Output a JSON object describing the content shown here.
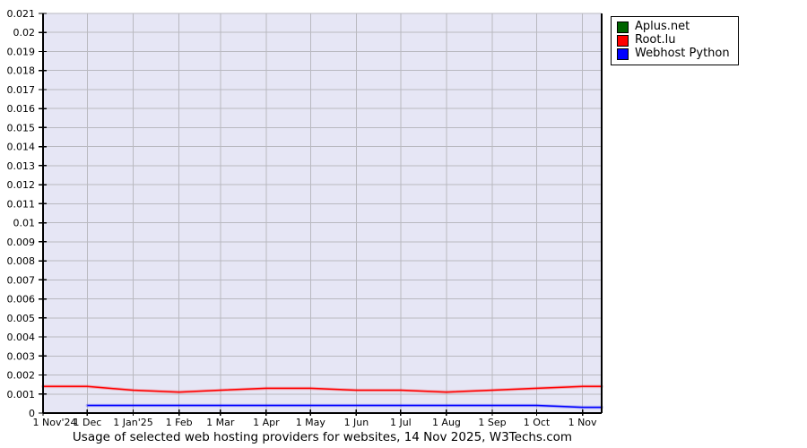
{
  "page": {
    "caption": "Usage of selected web hosting providers for websites, 14 Nov 2025, W3Techs.com"
  },
  "chart_data": {
    "type": "line",
    "title": "Usage of selected web hosting providers for websites, 14 Nov 2025, W3Techs.com",
    "xlabel": "",
    "ylabel": "",
    "ylim": [
      0,
      0.021
    ],
    "y_tick_step": 0.001,
    "y_tick_labels": [
      "0",
      "0.001",
      "0.002",
      "0.003",
      "0.004",
      "0.005",
      "0.006",
      "0.007",
      "0.008",
      "0.009",
      "0.01",
      "0.011",
      "0.012",
      "0.013",
      "0.014",
      "0.015",
      "0.016",
      "0.017",
      "0.018",
      "0.019",
      "0.02",
      "0.021"
    ],
    "x_total_days": 378,
    "x_tick_days": [
      0,
      30,
      61,
      92,
      120,
      151,
      181,
      212,
      242,
      273,
      304,
      334,
      365
    ],
    "x_tick_labels": [
      "1 Nov'24",
      "1 Dec",
      "1 Jan'25",
      "1 Feb",
      "1 Mar",
      "1 Apr",
      "1 May",
      "1 Jun",
      "1 Jul",
      "1 Aug",
      "1 Sep",
      "1 Oct",
      "1 Nov"
    ],
    "x_days": [
      0,
      30,
      61,
      92,
      120,
      151,
      181,
      212,
      242,
      273,
      304,
      334,
      365,
      378
    ],
    "series": [
      {
        "name": "Aplus.net",
        "color": "#006400",
        "values": [
          0,
          0,
          0,
          0,
          0,
          0,
          0,
          0,
          0,
          0,
          0,
          0,
          0,
          0
        ]
      },
      {
        "name": "Root.lu",
        "color": "#ff0000",
        "values": [
          0.0014,
          0.0014,
          0.0012,
          0.0011,
          0.0012,
          0.0013,
          0.0013,
          0.0012,
          0.0012,
          0.0011,
          0.0012,
          0.0013,
          0.0014,
          0.0014
        ]
      },
      {
        "name": "Webhost Python",
        "color": "#0000ff",
        "values": [
          null,
          0.0004,
          0.0004,
          0.0004,
          0.0004,
          0.0004,
          0.0004,
          0.0004,
          0.0004,
          0.0004,
          0.0004,
          0.0004,
          0.0003,
          0.0003
        ]
      }
    ],
    "grid": true,
    "legend_position": "top-right-outside",
    "colors": {
      "plot_bg": "#e6e6f5",
      "grid": "#b9b9c0",
      "axis": "#000000",
      "text": "#000000",
      "legend_bg": "#ffffff",
      "legend_border": "#000000"
    }
  }
}
